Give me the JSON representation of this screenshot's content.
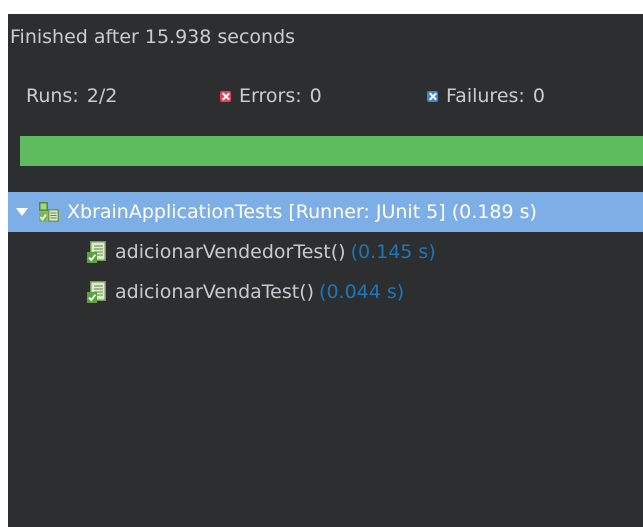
{
  "status": {
    "text": "Finished after 15.938 seconds"
  },
  "counters": {
    "runs_label": "Runs:",
    "runs_value": "2/2",
    "errors_label": "Errors:",
    "errors_value": "0",
    "failures_label": "Failures:",
    "failures_value": "0"
  },
  "progress": {
    "fraction": 1.0,
    "color": "#5ebb5e"
  },
  "tree": {
    "suite": {
      "label": "XbrainApplicationTests [Runner: JUnit 5] (0.189 s)",
      "icon": "test-suite-passed-icon"
    },
    "tests": [
      {
        "name": "adicionarVendedorTest()",
        "time": "(0.145 s)",
        "icon": "test-passed-icon"
      },
      {
        "name": "adicionarVendaTest()",
        "time": "(0.044 s)",
        "icon": "test-passed-icon"
      }
    ]
  },
  "colors": {
    "panel_bg": "#2d2e30",
    "selection": "#7eaee6",
    "time_text": "#1e76b8",
    "error": "#e0455a",
    "failure": "#3f86d8"
  }
}
